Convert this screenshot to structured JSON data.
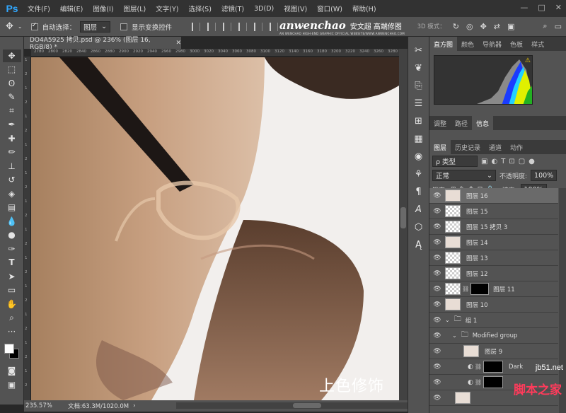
{
  "app": {
    "logo": "Ps"
  },
  "menu": [
    "文件(F)",
    "编辑(E)",
    "图像(I)",
    "图层(L)",
    "文字(Y)",
    "选择(S)",
    "滤镜(T)",
    "3D(D)",
    "视图(V)",
    "窗口(W)",
    "帮助(H)"
  ],
  "window_controls": {
    "minimize": "—",
    "maximize": "□",
    "close": "✕"
  },
  "options": {
    "auto_select_label": "自动选择：",
    "auto_select_value": "图层",
    "show_transform_label": "显示变换控件",
    "mode_3d_label": "3D 模式："
  },
  "brand": {
    "logo": "anwenchao",
    "cn": "安文超 高端修图",
    "sub": "AN WENCHAO HIGH-END GRAPHIC OFFICIAL WEBSITE/WWW.ANWENCHAO.COM"
  },
  "document": {
    "tab_title": "DO4A5925 拷贝.psd @ 236% (图层 16, RGB/8) *",
    "close": "✕",
    "caption": "上色修饰"
  },
  "ruler_top": [
    "2780",
    "2800",
    "2820",
    "2840",
    "2860",
    "2880",
    "2900",
    "2920",
    "2940",
    "2960",
    "2980",
    "3000",
    "3020",
    "3040",
    "3060",
    "3080",
    "3100",
    "3120",
    "3140",
    "3160",
    "3180",
    "3200",
    "3220",
    "3240",
    "3260",
    "3280"
  ],
  "ruler_left": [
    "1",
    "2",
    "1",
    "2",
    "1",
    "2",
    "1",
    "2",
    "1",
    "2",
    "1",
    "2",
    "1",
    "2",
    "1",
    "2",
    "1",
    "2",
    "1",
    "2",
    "1",
    "2",
    "1",
    "2"
  ],
  "status": {
    "zoom": "235.57%",
    "doc": "文档:63.3M/1020.0M"
  },
  "panel_tabs_top": [
    "直方图",
    "颜色",
    "导航器",
    "色板",
    "样式"
  ],
  "panel_tabs_mid": [
    "调整",
    "路径",
    "信息"
  ],
  "panel_tabs_layers": [
    "图层",
    "历史记录",
    "通道",
    "动作"
  ],
  "layers_panel": {
    "filter_label": "ρ 类型",
    "blend_mode": "正常",
    "opacity_label": "不透明度:",
    "opacity_value": "100%",
    "lock_label": "锁定:",
    "fill_label": "填充:",
    "fill_value": "100%"
  },
  "layers": [
    {
      "name": "图层 16",
      "thumb": "photo",
      "selected": true
    },
    {
      "name": "图层 15",
      "thumb": "checker"
    },
    {
      "name": "图层 15 拷贝 3",
      "thumb": "checker"
    },
    {
      "name": "图层 14",
      "thumb": "photo"
    },
    {
      "name": "图层 13",
      "thumb": "checker"
    },
    {
      "name": "图层 12",
      "thumb": "checker"
    },
    {
      "name": "图层 11",
      "thumb": "checker",
      "mask": true
    },
    {
      "name": "图层 10",
      "thumb": "photo"
    },
    {
      "name": "组 1",
      "type": "group"
    },
    {
      "name": "Modified group",
      "type": "group"
    },
    {
      "name": "图层 9",
      "thumb": "photo"
    },
    {
      "name": "Dark",
      "type": "adjustment",
      "mask": true
    },
    {
      "name": "",
      "type": "adjustment",
      "mask": true
    },
    {
      "name": "",
      "thumb": "photo"
    }
  ],
  "watermark": {
    "site": "jb51.net",
    "cn": "脚本之家"
  },
  "colors": {
    "accent": "#31a8ff",
    "panel": "#535353",
    "watermark_red": "#ff3b5b"
  }
}
